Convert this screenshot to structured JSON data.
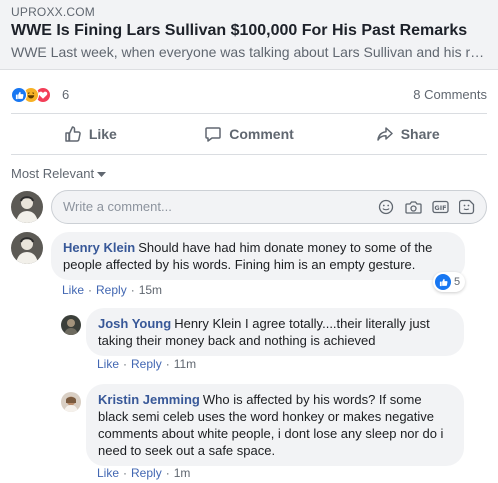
{
  "link": {
    "domain": "UPROXX.COM",
    "title": "WWE Is Fining Lars Sullivan $100,000 For His Past Remarks",
    "description": "WWE Last week, when everyone was talking about Lars Sullivan and his reprehensible past remarks"
  },
  "reactions": {
    "count": "6",
    "comments": "8 Comments",
    "icons": [
      "like-reaction-icon",
      "haha-reaction-icon",
      "love-reaction-icon"
    ],
    "colors": {
      "like": "#1877f2",
      "haha": "#f7b125",
      "love": "#f33e58"
    }
  },
  "actions": {
    "like": "Like",
    "comment": "Comment",
    "share": "Share"
  },
  "sort": {
    "label": "Most Relevant"
  },
  "composer": {
    "placeholder": "Write a comment..."
  },
  "comments": [
    {
      "author": "Henry Klein",
      "text": "Should have had him donate money to some of the people affected by his words. Fining him is an empty gesture.",
      "like": "Like",
      "reply": "Reply",
      "time": "15m",
      "likes": "5"
    },
    {
      "author": "Josh Young",
      "text": "Henry Klein I agree totally....their literally just taking their money back and nothing is achieved",
      "like": "Like",
      "reply": "Reply",
      "time": "11m"
    },
    {
      "author": "Kristin Jemming",
      "text": "Who is affected by his words? If some black semi celeb uses the word honkey or makes negative comments about white people, i dont lose any sleep nor do i need to seek out a safe space.",
      "like": "Like",
      "reply": "Reply",
      "time": "1m"
    }
  ],
  "colors": {
    "link": "#385898",
    "meta_link": "#4267b2",
    "muted": "#606770"
  }
}
